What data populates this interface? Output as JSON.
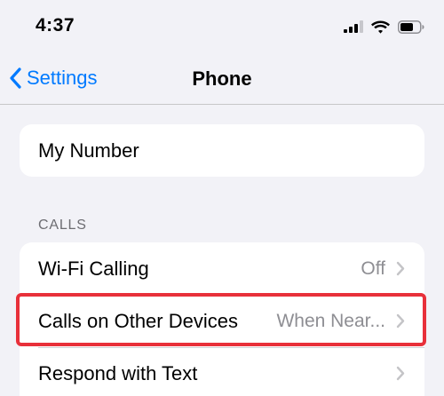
{
  "status_bar": {
    "time": "4:37",
    "icons": [
      "cellular-signal-icon",
      "wifi-icon",
      "battery-icon"
    ]
  },
  "nav": {
    "back_label": "Settings",
    "title": "Phone",
    "accent_color": "#007aff"
  },
  "my_number": {
    "label": "My Number"
  },
  "calls_section": {
    "header": "CALLS",
    "items": [
      {
        "label": "Wi-Fi Calling",
        "value": "Off"
      },
      {
        "label": "Calls on Other Devices",
        "value": "When Near..."
      },
      {
        "label": "Respond with Text",
        "value": ""
      }
    ]
  },
  "annotation": {
    "highlight_color": "#e8303a"
  }
}
